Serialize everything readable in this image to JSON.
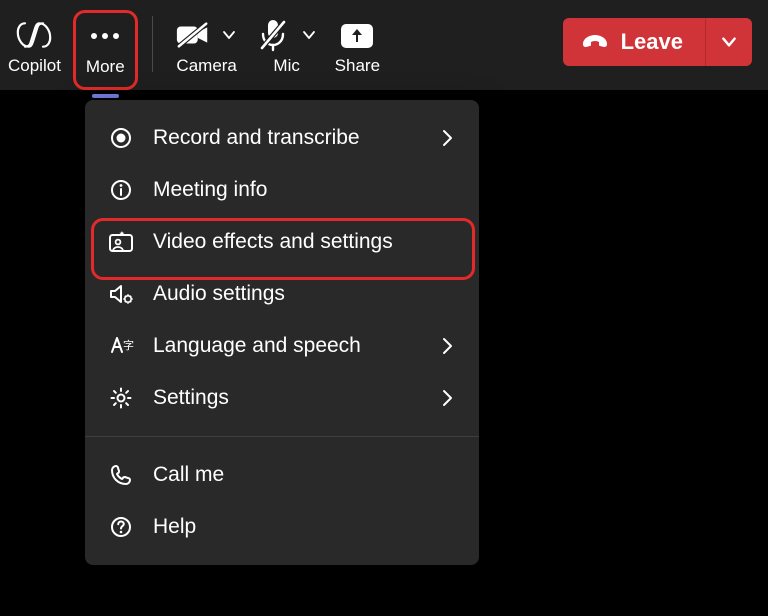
{
  "toolbar": {
    "copilot_label": "Copilot",
    "more_label": "More",
    "camera_label": "Camera",
    "mic_label": "Mic",
    "share_label": "Share",
    "leave_label": "Leave"
  },
  "menu": {
    "record": "Record and transcribe",
    "meeting_info": "Meeting info",
    "video_effects": "Video effects and settings",
    "audio_settings": "Audio settings",
    "language_speech": "Language and speech",
    "settings": "Settings",
    "call_me": "Call me",
    "help": "Help"
  }
}
